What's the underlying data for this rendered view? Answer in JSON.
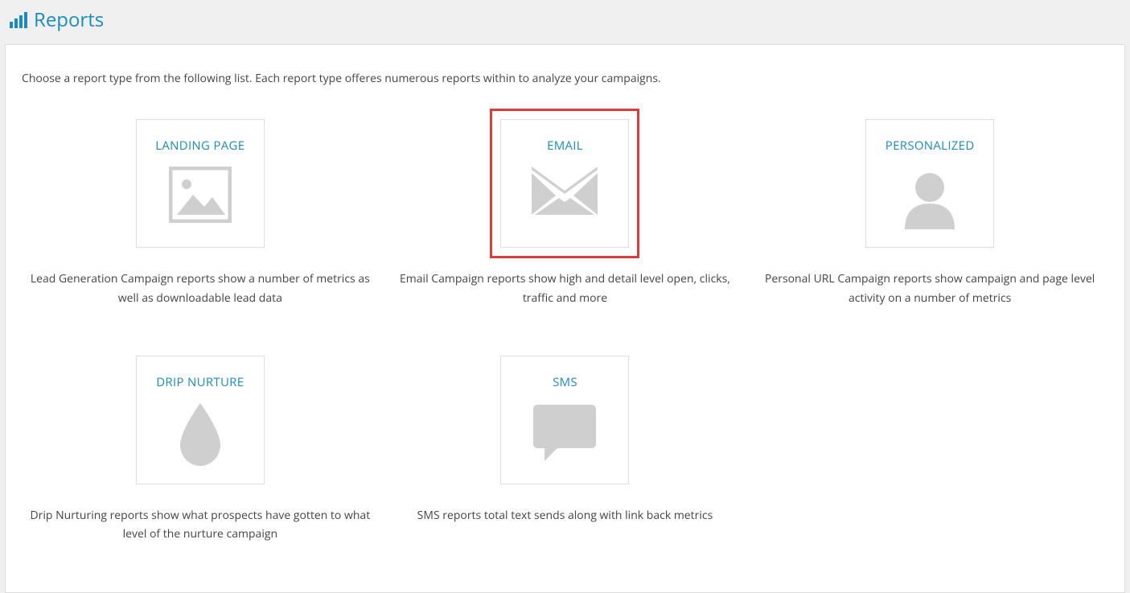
{
  "header": {
    "title": "Reports"
  },
  "intro": "Choose a report type from the following list. Each report type offeres numerous reports within to analyze your campaigns.",
  "cards": {
    "landing_page": {
      "title": "LANDING PAGE",
      "desc": "Lead Generation Campaign reports show a number of metrics as well as downloadable lead data"
    },
    "email": {
      "title": "EMAIL",
      "desc": "Email Campaign reports show high and detail level open, clicks, traffic and more"
    },
    "personalized": {
      "title": "PERSONALIZED",
      "desc": "Personal URL Campaign reports show campaign and page level activity on a number of metrics"
    },
    "drip_nurture": {
      "title": "DRIP NURTURE",
      "desc": "Drip Nurturing reports show what prospects have gotten to what level of the nurture campaign"
    },
    "sms": {
      "title": "SMS",
      "desc": "SMS reports total text sends along with link back metrics"
    }
  }
}
